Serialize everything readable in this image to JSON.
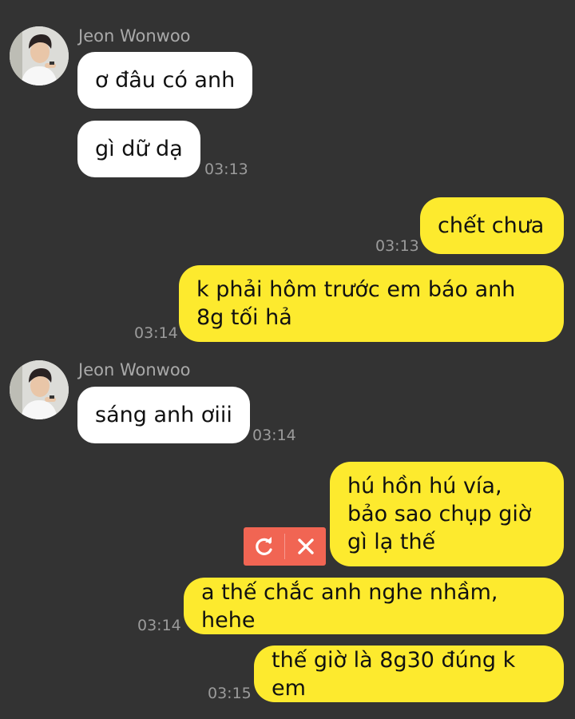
{
  "conversation": {
    "contact_name": "Jeon Wonwoo",
    "groups": [
      {
        "sender": "Jeon Wonwoo",
        "messages": [
          {
            "text": "ơ đâu có anh"
          },
          {
            "text": "gì dữ dạ",
            "time": "03:13"
          }
        ]
      },
      {
        "sender": "me",
        "messages": [
          {
            "text": "chết chưa",
            "time": "03:13"
          },
          {
            "text": "k phải hôm trước em báo anh 8g tối hả",
            "time": "03:14"
          }
        ]
      },
      {
        "sender": "Jeon Wonwoo",
        "messages": [
          {
            "text": "sáng anh ơiii",
            "time": "03:14"
          }
        ]
      },
      {
        "sender": "me",
        "messages": [
          {
            "text": "hú hồn hú vía, bảo sao chụp giờ gì lạ thế",
            "status": "failed"
          },
          {
            "text": "a thế chắc anh nghe nhầm, hehe",
            "time": "03:14"
          },
          {
            "text": "thế giờ là 8g30 đúng k em",
            "time": "03:15"
          }
        ]
      }
    ]
  },
  "failed_actions": {
    "retry_icon": "retry-icon",
    "delete_icon": "close-icon"
  },
  "colors": {
    "background": "#333333",
    "incoming_bubble": "#ffffff",
    "outgoing_bubble": "#fdea2e",
    "failed_action": "#f16553",
    "timestamp": "#9b9b9b",
    "sender_name": "#a9a9a9"
  }
}
